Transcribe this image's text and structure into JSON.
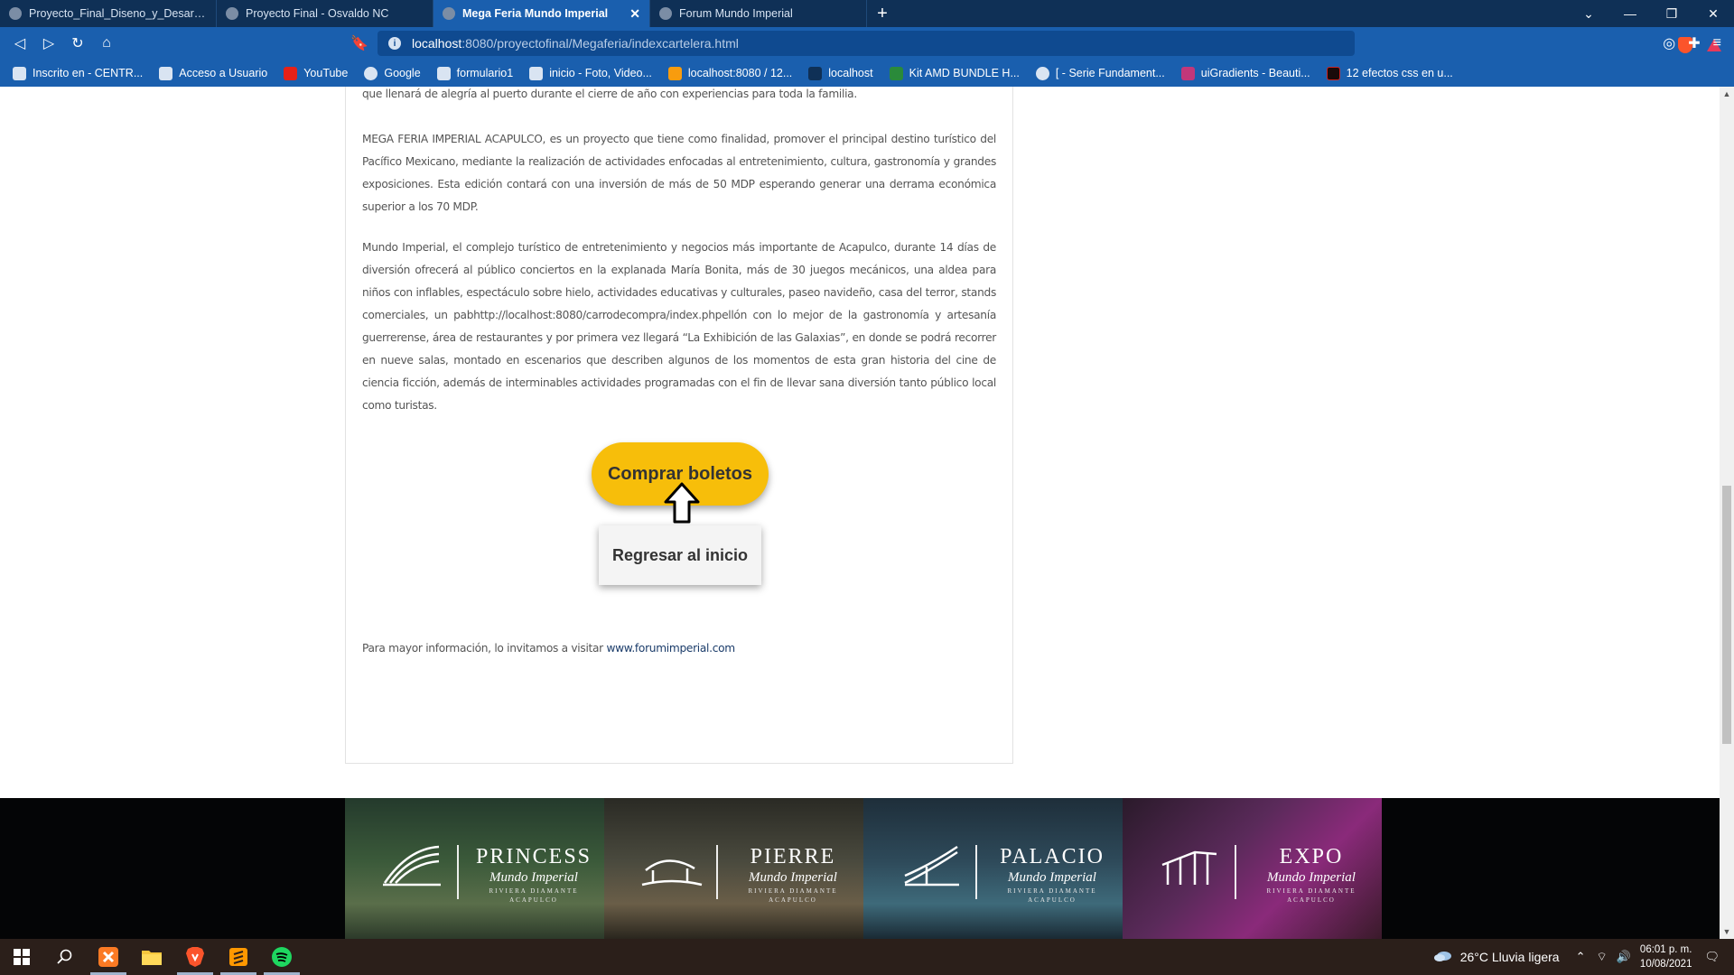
{
  "tabs": [
    {
      "title": "Proyecto_Final_Diseno_y_Desarrollo_C",
      "active": false
    },
    {
      "title": "Proyecto Final - Osvaldo NC",
      "active": false
    },
    {
      "title": "Mega Feria Mundo Imperial",
      "active": true
    },
    {
      "title": "Forum Mundo Imperial",
      "active": false
    }
  ],
  "address": {
    "host": "localhost",
    "path": ":8080/proyectofinal/Megaferia/indexcartelera.html"
  },
  "bookmarks": [
    "Inscrito en - CENTR...",
    "Acceso a Usuario",
    "YouTube",
    "Google",
    "formulario1",
    "inicio - Foto, Video...",
    "localhost:8080 / 12...",
    "localhost",
    "Kit AMD BUNDLE H...",
    "[ - Serie Fundament...",
    "uiGradients - Beauti...",
    "12 efectos css en u..."
  ],
  "content": {
    "p0": "que llenará de alegría al puerto durante el cierre de año con experiencias para toda la familia.",
    "p1": "MEGA FERIA IMPERIAL ACAPULCO, es un proyecto que tiene como finalidad, promover el principal destino turístico del Pacífico Mexicano, mediante la realización de actividades enfocadas al entretenimiento, cultura, gastronomía y grandes exposiciones. Esta edición contará con una inversión de más de 50 MDP esperando generar una derrama económica superior a los 70 MDP.",
    "p2": "Mundo Imperial, el complejo turístico de entretenimiento y negocios más importante de Acapulco, durante 14 días de diversión ofrecerá al público conciertos en la explanada María Bonita, más de 30 juegos mecánicos, una aldea para niños con inflables, espectáculo sobre hielo, actividades educativas y culturales, paseo navideño, casa del terror, stands comerciales, un pabhttp://localhost:8080/carrodecompra/index.phpellón con lo mejor de la gastronomía y artesanía guerrerense, área de restaurantes y por primera vez llegará “La Exhibición de las Galaxias”, en donde se podrá recorrer en nueve salas, montado en escenarios que describen algunos de los momentos de esta gran historia del cine de ciencia ficción, además de interminables actividades programadas con el fin de llevar sana diversión tanto público local como turistas.",
    "buy_button": "Comprar boletos",
    "home_button": "Regresar al inicio",
    "more_info_text": "Para mayor información, lo invitamos a visitar ",
    "more_info_link": "www.forumimperial.com"
  },
  "hotels": [
    {
      "name": "PRINCESS",
      "script": "Mundo Imperial",
      "sub1": "RIVIERA DIAMANTE",
      "sub2": "ACAPULCO",
      "color": "#3b5a3a"
    },
    {
      "name": "PIERRE",
      "script": "Mundo Imperial",
      "sub1": "RIVIERA DIAMANTE",
      "sub2": "ACAPULCO",
      "color": "#4a4a3e"
    },
    {
      "name": "PALACIO",
      "script": "Mundo Imperial",
      "sub1": "RIVIERA DIAMANTE",
      "sub2": "ACAPULCO",
      "color": "#2e4a5a"
    },
    {
      "name": "EXPO",
      "script": "Mundo Imperial",
      "sub1": "RIVIERA DIAMANTE",
      "sub2": "ACAPULCO",
      "color": "#5a2a5a"
    }
  ],
  "taskbar": {
    "weather": "26°C  Lluvia ligera",
    "time": "06:01 p. m.",
    "date": "10/08/2021"
  },
  "colors": {
    "accent_button": "#f7be0a",
    "chrome": "#1a5fae",
    "tabbar": "#0f3056"
  }
}
